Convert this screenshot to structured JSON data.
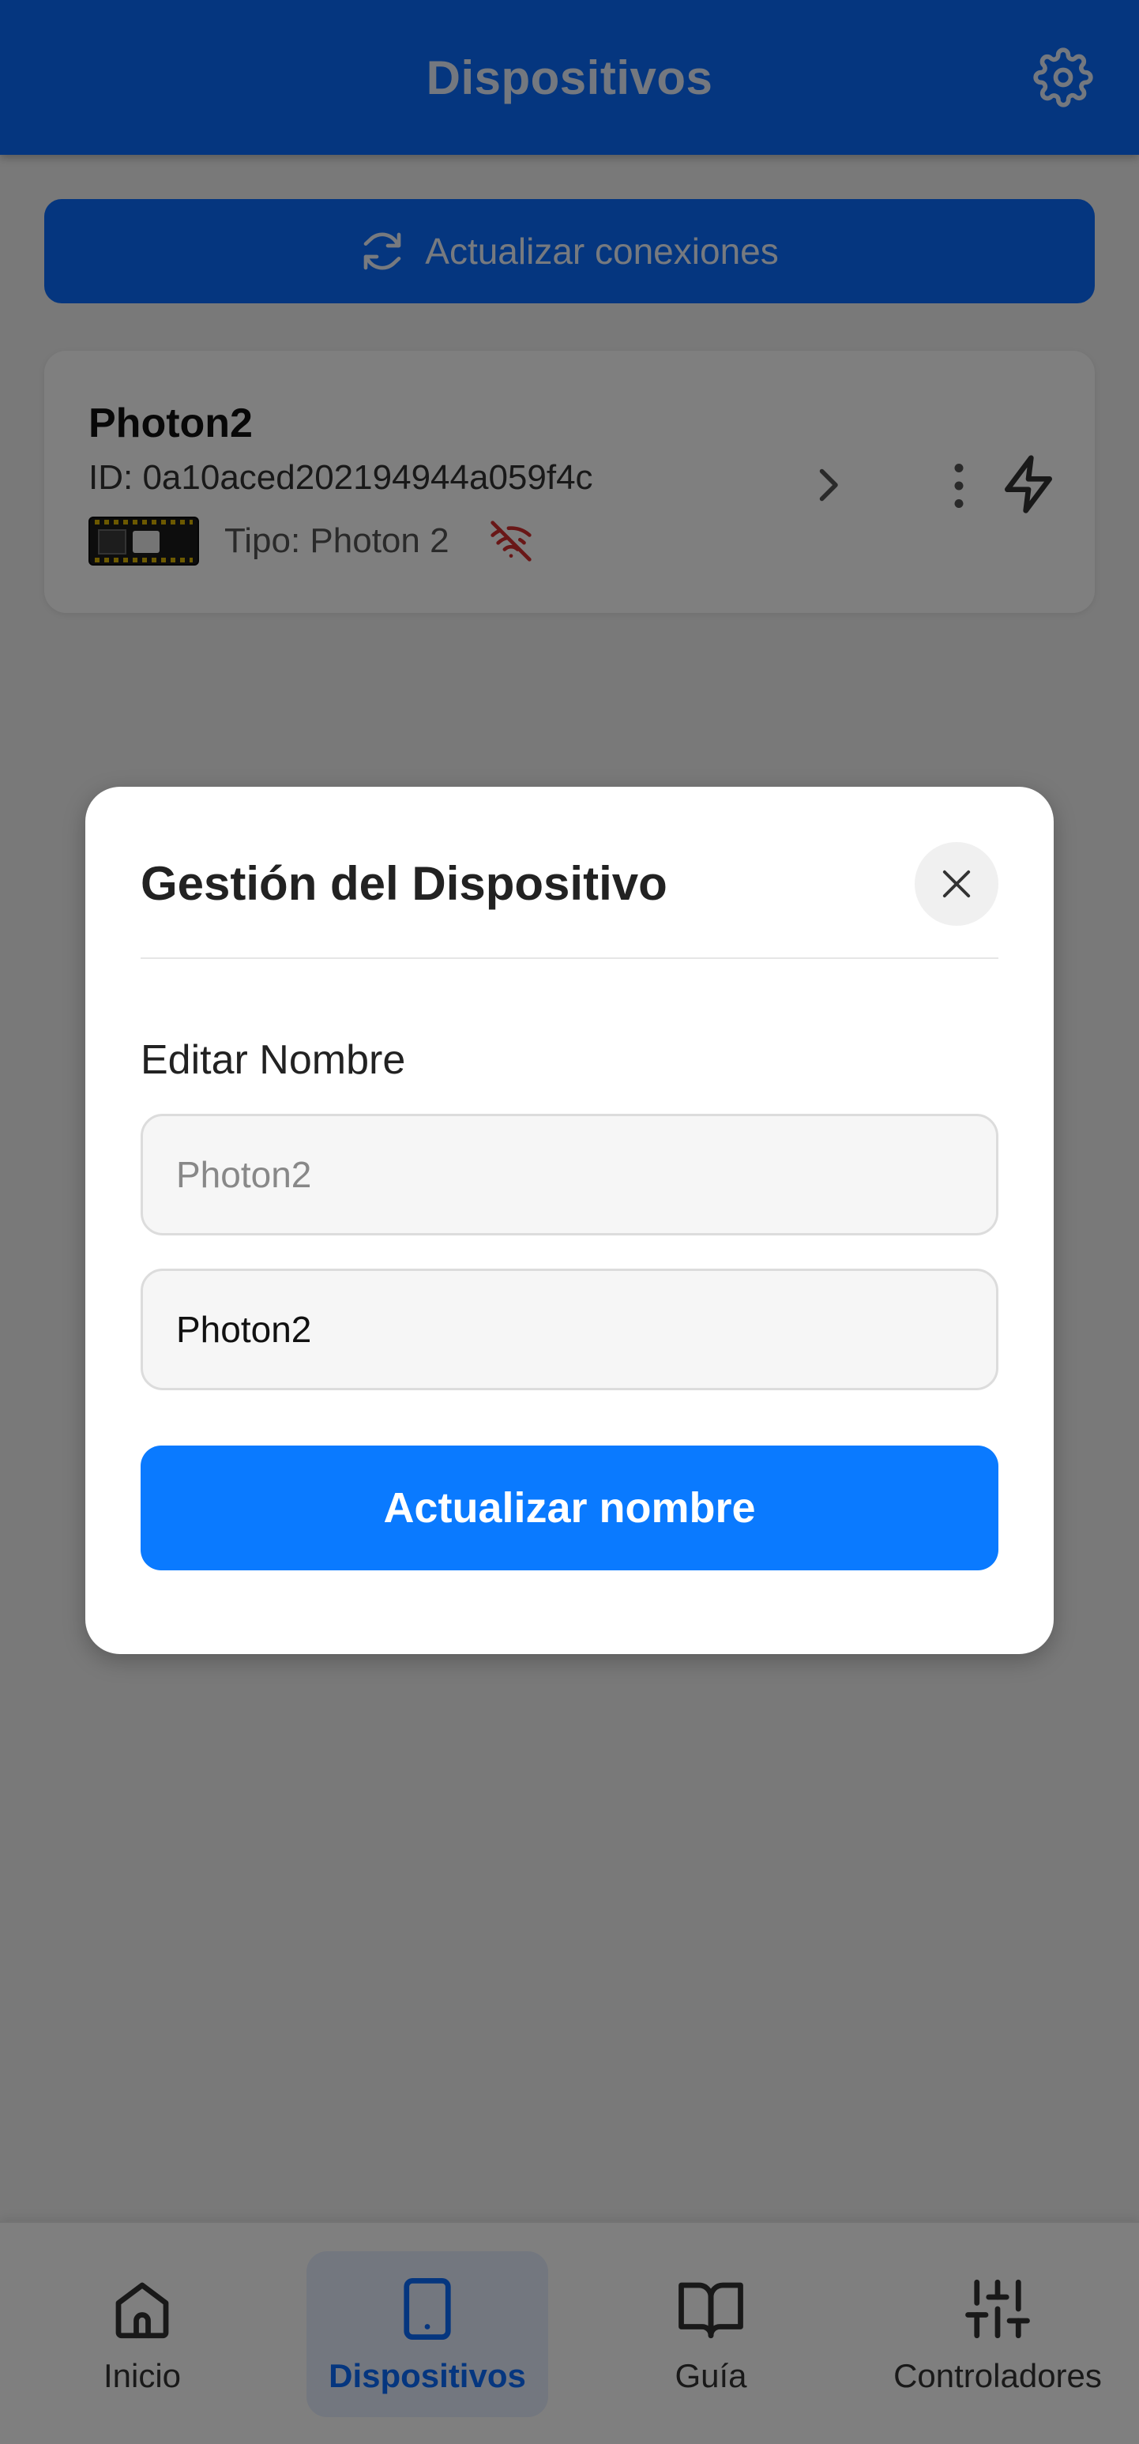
{
  "header": {
    "title": "Dispositivos",
    "settings_icon": "gear-icon",
    "color": "#0a6cff"
  },
  "toolbar": {
    "refresh_label": "Actualizar conexiones",
    "refresh_icon": "refresh-icon"
  },
  "device": {
    "name": "Photon2",
    "id_text": "ID: 0a10aced202194944a059f4c",
    "type_text": "Tipo: Photon 2",
    "status_icon": "wifi-off-icon",
    "status_color": "#d32f2f",
    "actions": [
      "chevron-right-icon",
      "more-vertical-icon",
      "flash-icon"
    ]
  },
  "modal": {
    "title": "Gestión del Dispositivo",
    "field_label": "Editar Nombre",
    "name_input_placeholder": "Photon2",
    "name_input_value": "Photon2",
    "submit_label": "Actualizar nombre",
    "close_icon": "close-icon",
    "accent": "#0a7aff"
  },
  "nav": {
    "items": [
      {
        "label": "Inicio",
        "icon": "home-icon",
        "active": false
      },
      {
        "label": "Dispositivos",
        "icon": "tablet-icon",
        "active": true
      },
      {
        "label": "Guía",
        "icon": "book-icon",
        "active": false
      },
      {
        "label": "Controladores",
        "icon": "sliders-icon",
        "active": false
      }
    ]
  }
}
